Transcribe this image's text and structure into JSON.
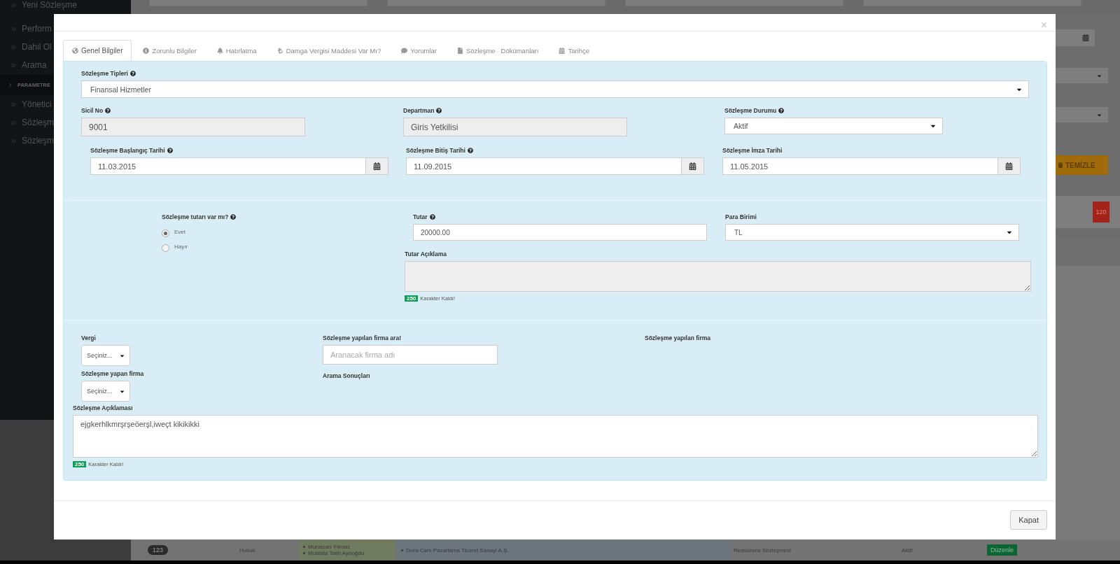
{
  "background": {
    "sidebar": {
      "items": [
        {
          "label": "Yeni Sözleşme"
        },
        {
          "label": "Perform"
        },
        {
          "label": "Dahil Ol"
        },
        {
          "label": "Arama"
        },
        {
          "label": "PARAMETRE",
          "kind": "section"
        },
        {
          "label": "Yönetici"
        },
        {
          "label": "Sözleşm"
        },
        {
          "label": "Sözleşm"
        }
      ]
    },
    "right_strip": {
      "clear_button": "TEMİZLE",
      "count_badge": "120"
    },
    "table_row": {
      "number": "123",
      "department": "Hukuk",
      "people": [
        "Muratcan Yılmaz",
        "Mustafa Talib Aydoğdu"
      ],
      "company": "Dora Cam Pazarlama Ticaret Sanayi A.Ş.",
      "contract_type": "Reasürans Sözleşmesi",
      "status": "Aktif",
      "edit_button": "Düzenle"
    }
  },
  "modal": {
    "close": "×",
    "tabs": [
      {
        "label": "Genel Bilgiler",
        "selected": true
      },
      {
        "label": "Zorunlu Bilgiler",
        "selected": false
      },
      {
        "label": "Hatırlatma",
        "selected": false
      },
      {
        "label": "Damga Vergisi Maddesi Var Mı?",
        "selected": false
      },
      {
        "label": "Yorumlar",
        "selected": false
      },
      {
        "label": "Sözleşme   Dökümanları",
        "selected": false
      },
      {
        "label": "Tarihçe",
        "selected": false
      }
    ],
    "form": {
      "contract_type": {
        "label": "Sözleşme Tipleri",
        "help": true,
        "value": "Finansal Hizmetler"
      },
      "registry_no": {
        "label": "Sicil No",
        "help": true,
        "value": "9001",
        "disabled": true
      },
      "department": {
        "label": "Departman",
        "help": true,
        "value": "Giris Yetkilisi",
        "disabled": true
      },
      "status": {
        "label": "Sözleşme Durumu",
        "help": true,
        "value": "Aktif"
      },
      "dates": [
        {
          "label": "Sözleşme Başlangıç Tarihi",
          "help": true,
          "value": "11.03.2015"
        },
        {
          "label": "Sözleşme Bitiş Tarihi",
          "help": true,
          "value": "11.09.2015"
        },
        {
          "label": "Sözleşme İmza Tarihi",
          "help": false,
          "value": "11.05.2015"
        }
      ],
      "amount_question": {
        "label": "Sözleşme tutarı var mı?",
        "help": true,
        "options": [
          {
            "label": "Evet",
            "selected": true
          },
          {
            "label": "Hayır",
            "selected": false
          }
        ]
      },
      "amount": {
        "label": "Tutar",
        "help": true,
        "value": "20000.00"
      },
      "currency": {
        "label": "Para Birimi",
        "help": false,
        "value": "TL"
      },
      "amount_note": {
        "label": "Tutar Açıklama",
        "disabled": true,
        "remaining": "250",
        "remaining_text": "Karakter Kaldı!"
      },
      "tax": {
        "label": "Vergi",
        "value": "Seçiniz..."
      },
      "contracting_company": {
        "label": "Sözleşme yapan firma",
        "value": "Seçiniz..."
      },
      "company_search": {
        "label": "Sözleşme yapılan firma ara!",
        "placeholder": "Aranacak firma adı",
        "results_label": "Arama Sonuçları"
      },
      "contracted_company": {
        "label": "Sözleşme yapılan firma"
      },
      "description": {
        "label": "Sözleşme Açıklaması",
        "value": "ejgkerhlkmrşrşeöerşl,iweçt kikikikki",
        "remaining": "250",
        "remaining_text": "Karakter Kaldı!"
      }
    },
    "footer": {
      "close_button": "Kapat"
    }
  }
}
